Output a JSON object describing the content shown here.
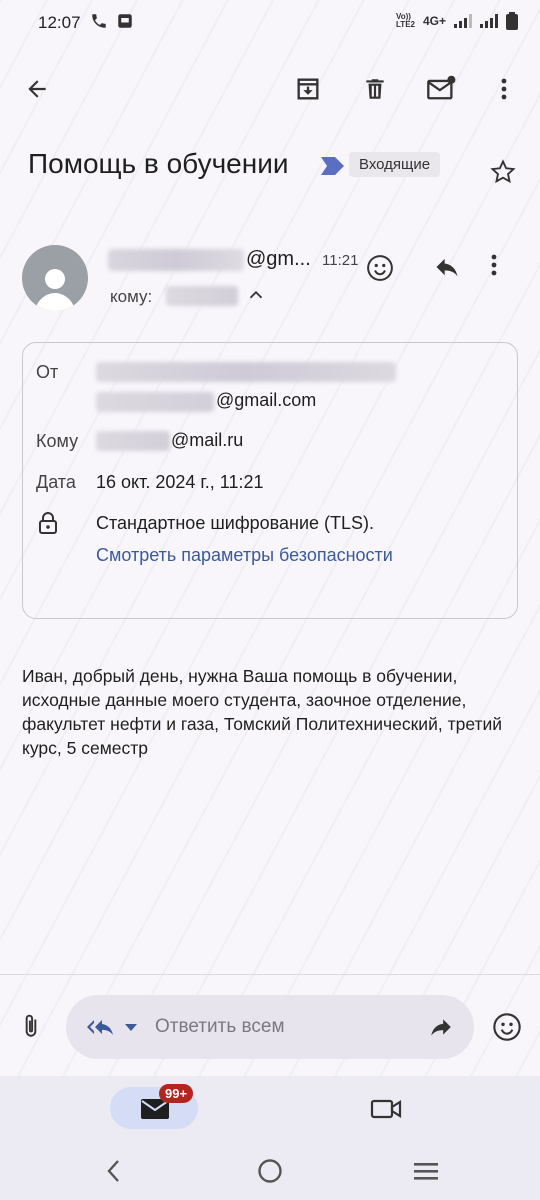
{
  "status_bar": {
    "time": "12:07",
    "lte_line1": "Vo))",
    "lte_line2": "LTE2",
    "network": "4G+"
  },
  "email": {
    "subject": "Помощь в обучении",
    "label": "Входящие",
    "sender_domain": "@gm...",
    "time": "11:21",
    "to_label": "кому:",
    "details": {
      "from_label": "От",
      "from_domain": "@gmail.com",
      "to_label": "Кому",
      "to_domain": "@mail.ru",
      "date_label": "Дата",
      "date_value": "16 окт. 2024 г., 11:21",
      "encryption": "Стандартное шифрование (TLS).",
      "security_link": "Смотреть параметры безопасности"
    },
    "body": "Иван, добрый день, нужна Ваша помощь в обучении, исходные данные моего студента, заочное отделение, факультет нефти и газа, Томский Политехнический, третий курс, 5 семестр"
  },
  "composer": {
    "placeholder": "Ответить всем"
  },
  "bottom_nav": {
    "badge": "99+"
  },
  "colors": {
    "accent": "#3c5a99",
    "badge": "#b3261e",
    "label_arrow": "#5b6fc2"
  }
}
